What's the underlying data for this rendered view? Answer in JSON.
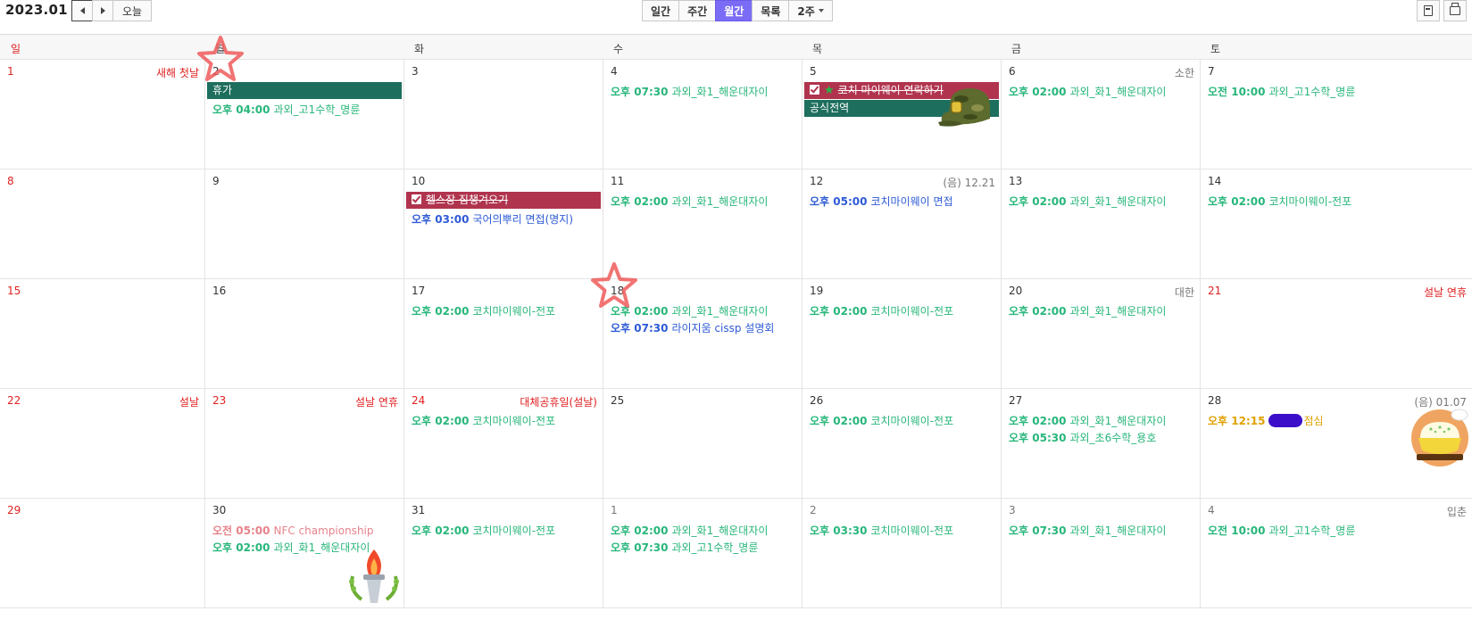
{
  "header": {
    "month": "2023.01",
    "today_label": "오늘",
    "views": [
      {
        "label": "일간",
        "active": false
      },
      {
        "label": "주간",
        "active": false
      },
      {
        "label": "월간",
        "active": true
      },
      {
        "label": "목록",
        "active": false
      },
      {
        "label": "2주",
        "active": false,
        "dropdown": true
      }
    ],
    "accent_color": "#7b6cf6",
    "right_icons": [
      "calculator-icon",
      "print-icon"
    ]
  },
  "weekdays": [
    "일",
    "월",
    "화",
    "수",
    "목",
    "금",
    "토"
  ],
  "weeks": [
    {
      "days": [
        {
          "num": "1",
          "holiday": "새해 첫날"
        },
        {
          "num": "2",
          "bars": [
            {
              "label": "휴가",
              "color": "green"
            }
          ],
          "events": [
            {
              "time": "오후 04:00",
              "title": "과외_고1수학_명륜",
              "color": "green"
            }
          ]
        },
        {
          "num": "3"
        },
        {
          "num": "4",
          "events": [
            {
              "time": "오후 07:30",
              "title": "과외_화1_해운대자이",
              "color": "green"
            }
          ]
        },
        {
          "num": "5",
          "bars": [
            {
              "label": "코치 마이웨이 연락하기",
              "color": "red",
              "done": true,
              "star": true
            },
            {
              "label": "공식전역",
              "color": "green"
            }
          ]
        },
        {
          "num": "6",
          "term": "소한",
          "events": [
            {
              "time": "오후 02:00",
              "title": "과외_화1_해운대자이",
              "color": "green"
            }
          ]
        },
        {
          "num": "7",
          "events": [
            {
              "time": "오전 10:00",
              "title": "과외_고1수학_명륜",
              "color": "green"
            }
          ]
        }
      ]
    },
    {
      "days": [
        {
          "num": "8"
        },
        {
          "num": "9"
        },
        {
          "num": "10",
          "bars": [
            {
              "label": "헬스장 짐챙겨오기",
              "color": "red",
              "done": true
            }
          ],
          "events": [
            {
              "time": "오후 03:00",
              "title": "국어의뿌리 면접(명지)",
              "color": "blue"
            }
          ]
        },
        {
          "num": "11",
          "events": [
            {
              "time": "오후 02:00",
              "title": "과외_화1_해운대자이",
              "color": "green"
            }
          ]
        },
        {
          "num": "12",
          "term": "(음) 12.21",
          "events": [
            {
              "time": "오후 05:00",
              "title": "코치마이웨이 면접",
              "color": "blue"
            }
          ]
        },
        {
          "num": "13",
          "events": [
            {
              "time": "오후 02:00",
              "title": "과외_화1_해운대자이",
              "color": "green"
            }
          ]
        },
        {
          "num": "14",
          "events": [
            {
              "time": "오후 02:00",
              "title": "코치마이웨이-전포",
              "color": "green"
            }
          ]
        }
      ]
    },
    {
      "days": [
        {
          "num": "15"
        },
        {
          "num": "16"
        },
        {
          "num": "17",
          "events": [
            {
              "time": "오후 02:00",
              "title": "코치마이웨이-전포",
              "color": "green"
            }
          ]
        },
        {
          "num": "18",
          "events": [
            {
              "time": "오후 02:00",
              "title": "과외_화1_해운대자이",
              "color": "green"
            },
            {
              "time": "오후 07:30",
              "title": "라이지움 cissp 설명회",
              "color": "blue"
            }
          ]
        },
        {
          "num": "19",
          "events": [
            {
              "time": "오후 02:00",
              "title": "코치마이웨이-전포",
              "color": "green"
            }
          ]
        },
        {
          "num": "20",
          "term": "대한",
          "events": [
            {
              "time": "오후 02:00",
              "title": "과외_화1_해운대자이",
              "color": "green"
            }
          ]
        },
        {
          "num": "21",
          "holiday": "설날 연휴"
        }
      ]
    },
    {
      "days": [
        {
          "num": "22",
          "holiday": "설날"
        },
        {
          "num": "23",
          "holiday": "설날 연휴"
        },
        {
          "num": "24",
          "holiday": "대체공휴일(설날)",
          "events": [
            {
              "time": "오후 02:00",
              "title": "코치마이웨이-전포",
              "color": "green"
            }
          ]
        },
        {
          "num": "25"
        },
        {
          "num": "26",
          "events": [
            {
              "time": "오후 02:00",
              "title": "코치마이웨이-전포",
              "color": "green"
            }
          ]
        },
        {
          "num": "27",
          "events": [
            {
              "time": "오후 02:00",
              "title": "과외_화1_해운대자이",
              "color": "green"
            },
            {
              "time": "오후 05:30",
              "title": "과외_초6수학_용호",
              "color": "green"
            }
          ]
        },
        {
          "num": "28",
          "term": "(음) 01.07",
          "events": [
            {
              "time": "오후 12:15",
              "title": "점심",
              "color": "orange",
              "scribble": true
            }
          ]
        }
      ]
    },
    {
      "days": [
        {
          "num": "29"
        },
        {
          "num": "30",
          "events": [
            {
              "time": "오전 05:00",
              "title": "NFC championship",
              "color": "pink"
            },
            {
              "time": "오후 02:00",
              "title": "과외_화1_해운대자이",
              "color": "green"
            }
          ]
        },
        {
          "num": "31",
          "events": [
            {
              "time": "오후 02:00",
              "title": "코치마이웨이-전포",
              "color": "green"
            }
          ]
        },
        {
          "num": "1",
          "other": true,
          "events": [
            {
              "time": "오후 02:00",
              "title": "과외_화1_해운대자이",
              "color": "green"
            },
            {
              "time": "오후 07:30",
              "title": "과외_고1수학_명륜",
              "color": "green"
            }
          ]
        },
        {
          "num": "2",
          "other": true,
          "events": [
            {
              "time": "오후 03:30",
              "title": "코치마이웨이-전포",
              "color": "green"
            }
          ]
        },
        {
          "num": "3",
          "other": true,
          "events": [
            {
              "time": "오후 07:30",
              "title": "과외_화1_해운대자이",
              "color": "green"
            }
          ]
        },
        {
          "num": "4",
          "other": true,
          "term": "입춘",
          "events": [
            {
              "time": "오전 10:00",
              "title": "과외_고1수학_명륜",
              "color": "green"
            }
          ]
        }
      ]
    }
  ],
  "stickers": [
    {
      "name": "star-sticker",
      "week": 0,
      "day": 1
    },
    {
      "name": "army-cap-sticker",
      "week": 0,
      "day": 4
    },
    {
      "name": "star-sticker",
      "week": 2,
      "day": 3
    },
    {
      "name": "rice-bowl-sticker",
      "week": 3,
      "day": 6
    },
    {
      "name": "torch-sticker",
      "week": 4,
      "day": 1
    }
  ]
}
